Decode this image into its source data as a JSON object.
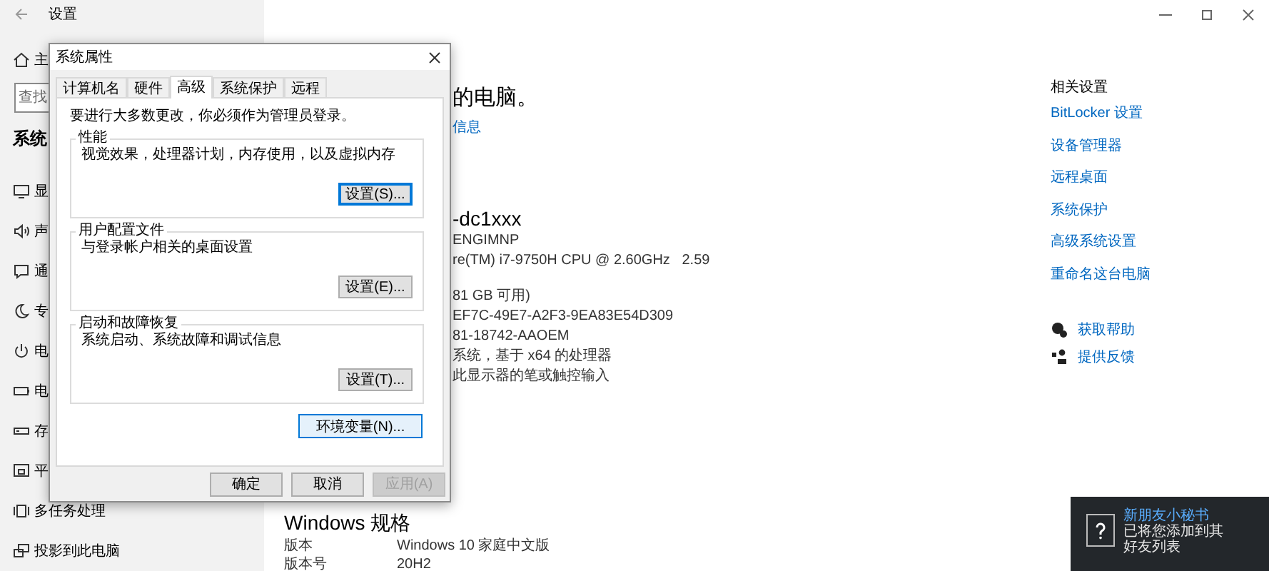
{
  "window": {
    "title": "设置"
  },
  "sidebar": {
    "home": "主",
    "search": {
      "placeholder": "查找"
    },
    "section": "系统",
    "items": [
      {
        "label": "显"
      },
      {
        "label": "声"
      },
      {
        "label": "通"
      },
      {
        "label": "专"
      },
      {
        "label": "电"
      },
      {
        "label": "电"
      },
      {
        "label": "存"
      },
      {
        "label": "平"
      },
      {
        "label": "多任务处理"
      },
      {
        "label": "投影到此电脑"
      }
    ]
  },
  "main": {
    "heading": "的电脑。",
    "link": "信息",
    "device_name": "-dc1xxx",
    "spec_groups": [
      [
        "ENGIMNP",
        "re(TM) i7-9750H CPU @ 2.60GHz   2.59"
      ],
      [
        "81 GB 可用)",
        "EF7C-49E7-A2F3-9EA83E54D309",
        "81-18742-AAOEM",
        "系统，基于 x64 的处理器",
        "此显示器的笔或触控输入"
      ]
    ],
    "windows_spec": {
      "title": "Windows 规格",
      "rows": [
        {
          "label": "版本",
          "value": "Windows 10 家庭中文版"
        },
        {
          "label": "版本号",
          "value": "20H2"
        }
      ]
    }
  },
  "related": {
    "title": "相关设置",
    "links": [
      "BitLocker 设置",
      "设备管理器",
      "远程桌面",
      "系统保护",
      "高级系统设置",
      "重命名这台电脑"
    ],
    "help": [
      "获取帮助",
      "提供反馈"
    ]
  },
  "dialog": {
    "title": "系统属性",
    "tabs": [
      {
        "label": "计算机名",
        "selected": false
      },
      {
        "label": "硬件",
        "selected": false
      },
      {
        "label": "高级",
        "selected": true
      },
      {
        "label": "系统保护",
        "selected": false
      },
      {
        "label": "远程",
        "selected": false
      }
    ],
    "intro": "要进行大多数更改，你必须作为管理员登录。",
    "groups": [
      {
        "title": "性能",
        "description": "视觉效果，处理器计划，内存使用，以及虚拟内存",
        "button": {
          "label": "设置(S)...",
          "focused": true
        }
      },
      {
        "title": "用户配置文件",
        "description": "与登录帐户相关的桌面设置",
        "button": {
          "label": "设置(E)...",
          "focused": false
        }
      },
      {
        "title": "启动和故障恢复",
        "description": "系统启动、系统故障和调试信息",
        "button": {
          "label": "设置(T)...",
          "focused": false
        }
      }
    ],
    "env_button": {
      "label": "环境变量(N)...",
      "hovered": true
    },
    "footer_buttons": [
      {
        "label": "确定",
        "disabled": false
      },
      {
        "label": "取消",
        "disabled": false
      },
      {
        "label": "应用(A)",
        "disabled": true
      }
    ]
  },
  "toast": {
    "title": "新朋友小秘书",
    "lines": [
      "已将您添加到其",
      "好友列表"
    ]
  }
}
